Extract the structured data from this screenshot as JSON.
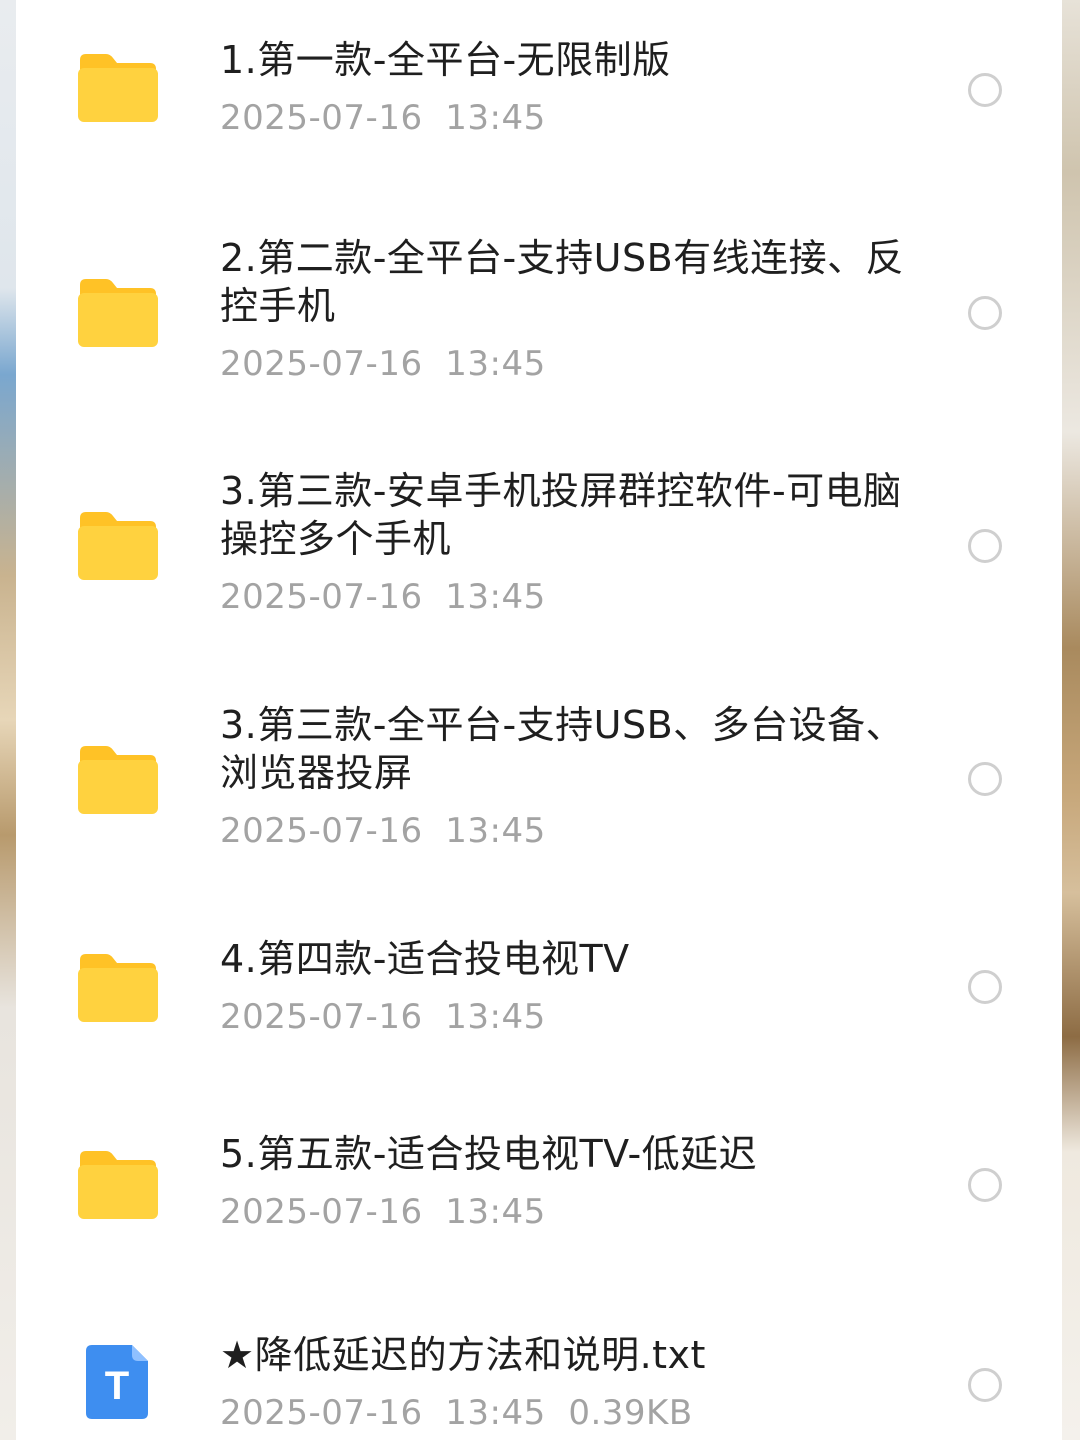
{
  "colors": {
    "folder": "#ffcf3c",
    "folder_tab": "#ffc226",
    "txt_icon": "#3e8ef0",
    "name": "#1f1f1f",
    "meta": "#a3a3a3"
  },
  "files": [
    {
      "type": "folder-icon",
      "name": "1.第一款-全平台-无限制版",
      "date": "2025-07-16",
      "time": "13:45",
      "size": ""
    },
    {
      "type": "folder-icon",
      "name": "2.第二款-全平台-支持USB有线连接、反控手机",
      "date": "2025-07-16",
      "time": "13:45",
      "size": ""
    },
    {
      "type": "folder-icon",
      "name": "3.第三款-安卓手机投屏群控软件-可电脑操控多个手机",
      "date": "2025-07-16",
      "time": "13:45",
      "size": ""
    },
    {
      "type": "folder-icon",
      "name": "3.第三款-全平台-支持USB、多台设备、浏览器投屏",
      "date": "2025-07-16",
      "time": "13:45",
      "size": ""
    },
    {
      "type": "folder-icon",
      "name": "4.第四款-适合投电视TV",
      "date": "2025-07-16",
      "time": "13:45",
      "size": ""
    },
    {
      "type": "folder-icon",
      "name": "5.第五款-适合投电视TV-低延迟",
      "date": "2025-07-16",
      "time": "13:45",
      "size": ""
    },
    {
      "type": "txt-file-icon",
      "icon_letter": "T",
      "name": "★降低延迟的方法和说明.txt",
      "date": "2025-07-16",
      "time": "13:45",
      "size": "0.39KB"
    }
  ]
}
